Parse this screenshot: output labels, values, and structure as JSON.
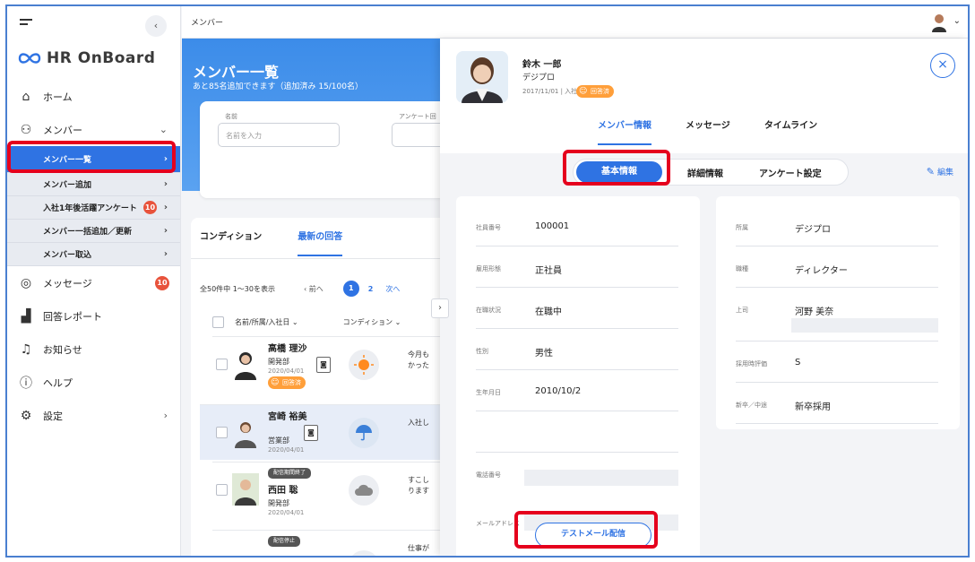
{
  "topbar": {
    "breadcrumb": "メンバー"
  },
  "sidebar": {
    "brand": "HR OnBoard",
    "items": [
      {
        "label": "ホーム",
        "icon": "home-icon"
      },
      {
        "label": "メンバー",
        "icon": "members-icon"
      },
      {
        "label": "メッセージ",
        "icon": "message-icon",
        "badge": "10"
      },
      {
        "label": "回答レポート",
        "icon": "report-icon"
      },
      {
        "label": "お知らせ",
        "icon": "bell-icon"
      },
      {
        "label": "ヘルプ",
        "icon": "help-icon"
      },
      {
        "label": "設定",
        "icon": "gear-icon"
      }
    ],
    "sub": [
      {
        "label": "メンバー一覧"
      },
      {
        "label": "メンバー追加"
      },
      {
        "label": "入社1年後活躍アンケート",
        "badge": "10"
      },
      {
        "label": "メンバー一括追加／更新"
      },
      {
        "label": "メンバー取込"
      }
    ]
  },
  "main": {
    "title": "メンバー一覧",
    "subtitle": "あと85名追加できます（追加済み 15/100名）",
    "filter": {
      "name_label": "名前",
      "name_placeholder": "名前を入力",
      "survey_label": "アンケート回"
    },
    "tabs": [
      "コンディション",
      "最新の回答"
    ],
    "pager": {
      "summary": "全50件中 1〜30を表示",
      "prev": "前へ",
      "p1": "1",
      "p2": "2",
      "next": "次へ"
    },
    "columns": {
      "name": "名前/所属/入社日",
      "condition": "コンディション"
    },
    "rows": [
      {
        "name": "高橋 理沙",
        "dept": "開発部",
        "date": "2020/04/01",
        "tag": "回答済",
        "text": "今月も\nかった"
      },
      {
        "name": "宮崎 裕美",
        "dept": "営業部",
        "date": "2020/04/01",
        "text": "入社し"
      },
      {
        "name": "西田 聡",
        "dept": "開発部",
        "date": "2020/04/01",
        "tag": "配信期間終了",
        "text": "すこし\nります"
      },
      {
        "name": "",
        "dept": "",
        "date": "",
        "tag": "配信停止",
        "text": "仕事が"
      }
    ]
  },
  "panel": {
    "name": "鈴木 一郎",
    "company": "デジプロ",
    "join": "2017/11/01 | 入社41ヶ月",
    "tag": "回答済",
    "tabs": [
      "メンバー情報",
      "メッセージ",
      "タイムライン"
    ],
    "segments": [
      "基本情報",
      "詳細情報",
      "アンケート設定"
    ],
    "edit": "編集",
    "left_fields": [
      {
        "k": "社員番号",
        "v": "100001"
      },
      {
        "k": "雇用形態",
        "v": "正社員"
      },
      {
        "k": "在職状況",
        "v": "在職中"
      },
      {
        "k": "性別",
        "v": "男性"
      },
      {
        "k": "生年月日",
        "v": "2010/10/2"
      },
      {
        "k": "",
        "v": ""
      },
      {
        "k": "電話番号",
        "v": ""
      },
      {
        "k": "メールアドレス",
        "v": ""
      }
    ],
    "right_fields": [
      {
        "k": "所属",
        "v": "デジプロ"
      },
      {
        "k": "職種",
        "v": "ディレクター"
      },
      {
        "k": "上司",
        "v": "河野 美奈"
      },
      {
        "k": "採用時評価",
        "v": "S"
      },
      {
        "k": "新卒／中途",
        "v": "新卒採用"
      }
    ],
    "test_mail": "テストメール配信"
  },
  "colors": {
    "accent": "#2f73e3",
    "highlight": "#e5001d",
    "badge": "#e8533c",
    "answered": "#ff9f3a"
  }
}
